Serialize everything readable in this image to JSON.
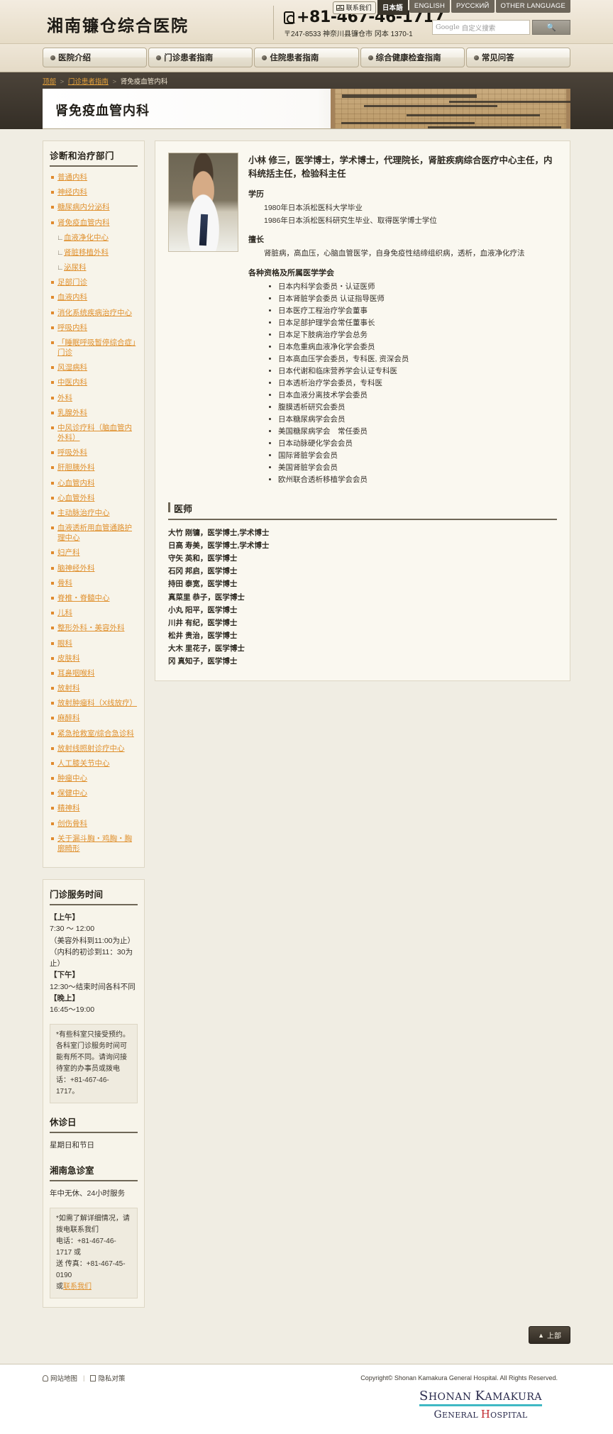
{
  "header": {
    "logo_text": "湘南镰仓综合医院",
    "tel": "+81-467-46-1717",
    "address": "〒247-8533  神奈川县镰仓市 冈本 1370-1",
    "contact_label": "联系我们",
    "lang_tabs": [
      {
        "label": "日本語",
        "active": true
      },
      {
        "label": "ENGLISH",
        "active": false
      },
      {
        "label": "РУССКИЙ",
        "active": false
      },
      {
        "label": "OTHER LANGUAGE",
        "active": false
      }
    ],
    "search": {
      "brand": "Google",
      "placeholder": "自定义搜索",
      "button_icon": "search-icon"
    }
  },
  "nav": {
    "items": [
      "医院介绍",
      "门诊患者指南",
      "住院患者指南",
      "综合健康检查指南",
      "常见问答"
    ]
  },
  "breadcrumb": {
    "items": [
      "顶部",
      "门诊患者指南"
    ],
    "current": "肾免疫血管内科",
    "separator": ">"
  },
  "page": {
    "title": "肾免疫血管内科"
  },
  "sidebar": {
    "departments_title": "诊断和治疗部门",
    "departments": [
      {
        "label": "普通内科",
        "sub": false
      },
      {
        "label": "神经内科",
        "sub": false
      },
      {
        "label": "糖尿病内分泌科",
        "sub": false
      },
      {
        "label": "肾免疫血管内科",
        "sub": false
      },
      {
        "label": "血液净化中心",
        "sub": true
      },
      {
        "label": "肾脏移植外科",
        "sub": true
      },
      {
        "label": "泌尿科",
        "sub": true
      },
      {
        "label": "足部门诊",
        "sub": false
      },
      {
        "label": "血液内科",
        "sub": false
      },
      {
        "label": "消化系统疾病治疗中心",
        "sub": false
      },
      {
        "label": "呼吸内科",
        "sub": false
      },
      {
        "label": "「睡眠呼吸暂停综合症」门诊",
        "sub": false
      },
      {
        "label": "风湿病科",
        "sub": false
      },
      {
        "label": "中医内科",
        "sub": false
      },
      {
        "label": "外科",
        "sub": false
      },
      {
        "label": "乳腺外科",
        "sub": false
      },
      {
        "label": "中风诊疗科（脑血管内外科）",
        "sub": false
      },
      {
        "label": "呼吸外科",
        "sub": false
      },
      {
        "label": "肝胆胰外科",
        "sub": false
      },
      {
        "label": "心血管内科",
        "sub": false
      },
      {
        "label": "心血管外科",
        "sub": false
      },
      {
        "label": "主动脉治疗中心",
        "sub": false
      },
      {
        "label": "血液透析用血管通路护理中心",
        "sub": false
      },
      {
        "label": "妇产科",
        "sub": false
      },
      {
        "label": "脑神经外科",
        "sub": false
      },
      {
        "label": "骨科",
        "sub": false
      },
      {
        "label": "脊椎・脊髓中心",
        "sub": false
      },
      {
        "label": "儿科",
        "sub": false
      },
      {
        "label": "整形外科・美容外科",
        "sub": false
      },
      {
        "label": "眼科",
        "sub": false
      },
      {
        "label": "皮肤科",
        "sub": false
      },
      {
        "label": "耳鼻咽喉科",
        "sub": false
      },
      {
        "label": "放射科",
        "sub": false
      },
      {
        "label": "放射肿瘤科（X线放疗）",
        "sub": false
      },
      {
        "label": "麻醉科",
        "sub": false
      },
      {
        "label": "紧急抢救室/综合急诊科",
        "sub": false
      },
      {
        "label": "放射线照射诊疗中心",
        "sub": false
      },
      {
        "label": "人工膝关节中心",
        "sub": false
      },
      {
        "label": "肿瘤中心",
        "sub": false
      },
      {
        "label": "保健中心",
        "sub": false
      },
      {
        "label": "精神科",
        "sub": false
      },
      {
        "label": "创伤骨科",
        "sub": false
      },
      {
        "label": "关于漏斗胸・鸡胸・胸廓畸形",
        "sub": false
      }
    ],
    "hours_title": "门诊服务时间",
    "hours": [
      {
        "text": "【上午】",
        "bold": true
      },
      {
        "text": "7:30 ～ 12:00",
        "bold": false
      },
      {
        "text": "（美容外科到11:00为止）",
        "bold": false
      },
      {
        "text": "（内科的初诊到11：30为止）",
        "bold": false
      },
      {
        "text": "【下午】",
        "bold": true
      },
      {
        "text": "12:30～结束时间各科不同",
        "bold": false
      },
      {
        "text": "【晚上】",
        "bold": true
      },
      {
        "text": "16:45～19:00",
        "bold": false
      }
    ],
    "hours_note": "*有些科室只接受预约。各科室门诊服务时间可能有所不同。请询问接待室的办事员或拨电话：+81-467-46-1717。",
    "closed_title": "休诊日",
    "closed_text": "星期日和节日",
    "er_title": "湘南急诊室",
    "er_text": "年中无休、24小时服务",
    "er_note_line1": "*如需了解详细情况，请拨电联系我们",
    "er_note_line2": "电话：+81-467-46-1717 或",
    "er_note_line3": "送 传真：+81-467-45-0190",
    "er_note_line4_prefix": "或",
    "er_note_link": "联系我们"
  },
  "main": {
    "doctor_photo_alt": "doctor-portrait",
    "doctor_name": "小林 修三，医学博士，学术博士，代理院长，肾脏疾病综合医疗中心主任，内科统括主任，检验科主任",
    "education_label": "学历",
    "education": [
      "1980年日本浜松医科大学毕业",
      "1986年日本浜松医科研究生毕业、取得医学博士学位"
    ],
    "specialty_label": "擅长",
    "specialty": "肾脏病，高血压，心脑血管医学，自身免疫性结缔组织病，透析，血液净化疗法",
    "qualifications_label": "各种资格及所属医学学会",
    "qualifications": [
      "日本内科学会委员・认证医师",
      "日本肾脏学会委员 认证指导医师",
      "日本医疗工程治疗学会董事",
      "日本足部护理学会常任董事长",
      "日本足下肢病治疗学会总务",
      "日本危重病血液净化学会委员",
      "日本高血压学会委员，专科医, 资深会员",
      "日本代谢和临床营养学会认证专科医",
      "日本透析治疗学会委员，专科医",
      "日本血液分离技术学会委员",
      "腹膜透析研究会委员",
      "日本糖尿病学会会员",
      "美国糖尿病学会　常任委员",
      "日本动脉硬化学会会员",
      "国际肾脏学会会员",
      "美国肾脏学会会员",
      "欧州联合透析移植学会会员"
    ],
    "doctors_heading": "医师",
    "doctors": [
      "大竹 刚镛，医学博士,学术博士",
      "日高 寿美，医学博士,学术博士",
      "守矢 英和，医学博士",
      "石冈 邦启，医学博士",
      "持田 泰宽，医学博士",
      "真菜里 恭子，医学博士",
      "小丸 阳平，医学博士",
      "川井 有纪，医学博士",
      "松井 贵治，医学博士",
      "大木 里花子，医学博士",
      "冈 真知子，医学博士"
    ],
    "top_button": "上部"
  },
  "footer": {
    "sitemap": "网站地图",
    "privacy": "隐私对策",
    "copyright": "Copyright© Shonan Kamakura General Hospital.  All Rights Reserved.",
    "logo_line1_a": "S",
    "logo_line1_b": "HONAN ",
    "logo_line1_c": "K",
    "logo_line1_d": "AMAKURA",
    "logo_line2_a": "G",
    "logo_line2_b": "ENERAL ",
    "logo_line2_c": "H",
    "logo_line2_d": "OSPITAL"
  },
  "colors": {
    "accent_orange": "#e0912f",
    "header_beige": "#ece3d2",
    "dark_band": "#342e26",
    "logo_teal": "#3fb8c4",
    "logo_red": "#c0282d"
  }
}
